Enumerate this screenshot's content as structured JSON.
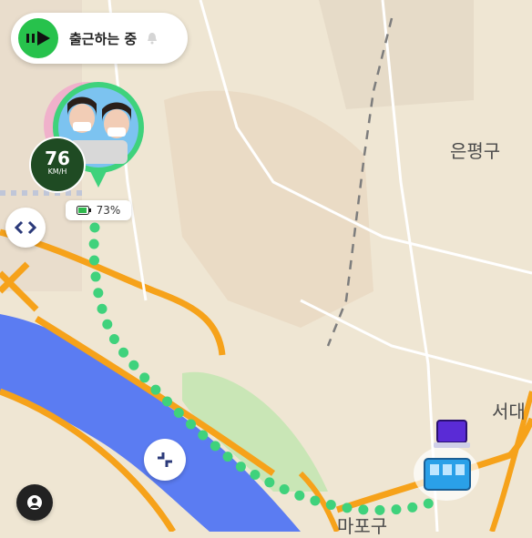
{
  "status": {
    "text": "출근하는 중"
  },
  "speed": {
    "value": "76",
    "unit": "KM/H"
  },
  "battery": {
    "percent": "73%"
  },
  "map_labels": {
    "district1": "은평구",
    "district2": "서대",
    "district3": "마포구"
  },
  "colors": {
    "route": "#3fd27c",
    "road": "#f6a21a",
    "river": "#5b7cf2",
    "park": "#bfe3b0",
    "status_accent": "#27c24c"
  },
  "icons": {
    "status": "double-arrow-right-icon",
    "bell": "bell-icon",
    "collapse": "chevron-pair-icon",
    "center": "crosshair-icon",
    "profile": "person-icon",
    "building": "building-icon"
  }
}
